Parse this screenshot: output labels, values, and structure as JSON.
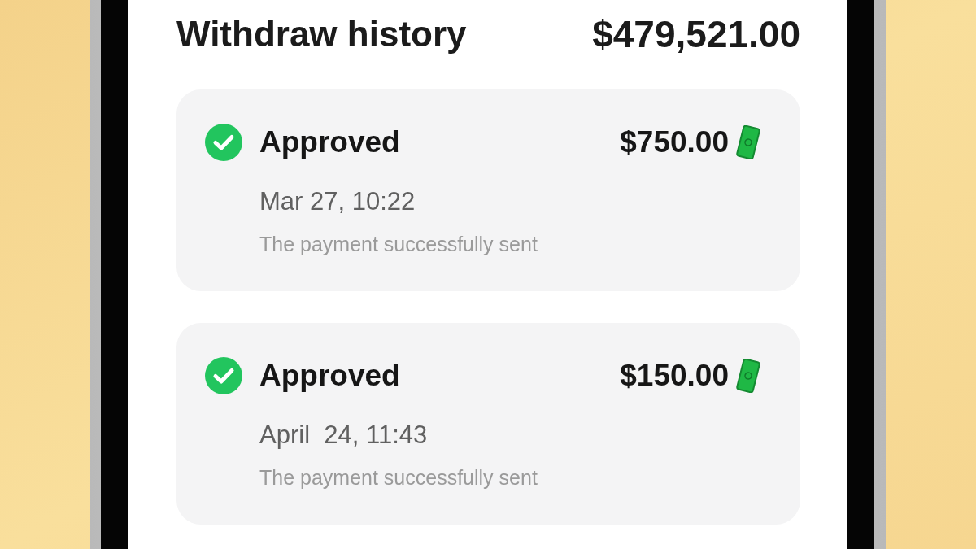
{
  "header": {
    "title": "Withdraw history",
    "total": "$479,521.00"
  },
  "withdrawals": [
    {
      "status": "Approved",
      "amount": "$750.00",
      "date": "Mar 27, 10:22",
      "message": "The payment successfully sent"
    },
    {
      "status": "Approved",
      "amount": "$150.00",
      "date": "April  24, 11:43",
      "message": "The payment successfully sent"
    }
  ]
}
